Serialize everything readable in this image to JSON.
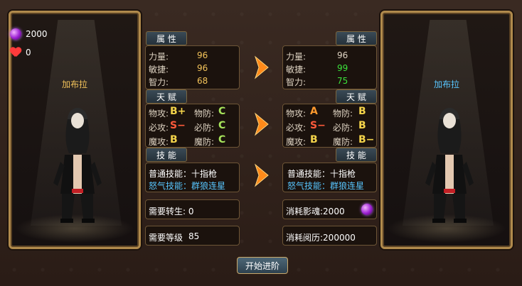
{
  "left": {
    "gem_count": "2000",
    "heart_count": "0",
    "name": "加布拉",
    "attrs": {
      "title": "属 性",
      "rows": [
        {
          "label": "力量:",
          "value": "96"
        },
        {
          "label": "敏捷:",
          "value": "96"
        },
        {
          "label": "智力:",
          "value": "68"
        }
      ]
    },
    "talent": {
      "title": "天 赋",
      "rows": [
        {
          "a_label": "物攻:",
          "a_grade": "B+",
          "b_label": "物防:",
          "b_grade": "C"
        },
        {
          "a_label": "必攻:",
          "a_grade": "S−",
          "b_label": "必防:",
          "b_grade": "C"
        },
        {
          "a_label": "魔攻:",
          "a_grade": "B",
          "b_label": "魔防:",
          "b_grade": "C"
        }
      ]
    },
    "skills": {
      "title": "技 能",
      "normal": "普通技能：十指枪",
      "rage": "怒气技能：群狼连星"
    },
    "req1": "需要转生: 0",
    "req2_label": "需要等级",
    "req2_value": "85"
  },
  "right": {
    "name": "加布拉",
    "attrs": {
      "title": "属 性",
      "rows": [
        {
          "label": "力量:",
          "value": "96"
        },
        {
          "label": "敏捷:",
          "value": "99"
        },
        {
          "label": "智力:",
          "value": "75"
        }
      ]
    },
    "talent": {
      "title": "天 赋",
      "rows": [
        {
          "a_label": "物攻:",
          "a_grade": "A",
          "b_label": "物防:",
          "b_grade": "B"
        },
        {
          "a_label": "必攻:",
          "a_grade": "S−",
          "b_label": "必防:",
          "b_grade": "B"
        },
        {
          "a_label": "魔攻:",
          "a_grade": "B",
          "b_label": "魔防:",
          "b_grade": "B−"
        }
      ]
    },
    "skills": {
      "title": "技 能",
      "normal": "普通技能：十指枪",
      "rage": "怒气技能：群狼连星"
    },
    "cost1": "消耗影魂:2000",
    "cost2": "消耗阅历:200000"
  },
  "button": "开始进阶",
  "colors": {
    "green_improved": "#3be33b",
    "gold": "#f3c35a",
    "blue_name": "#58c6ff",
    "rage_text": "#58c6ff"
  }
}
